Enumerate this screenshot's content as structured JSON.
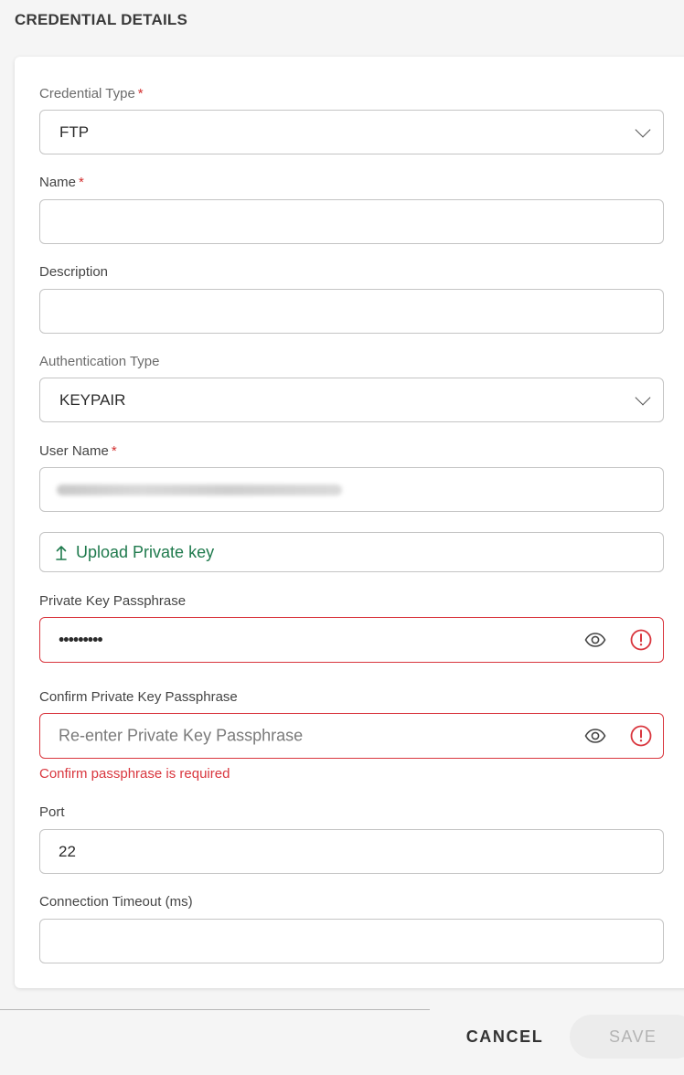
{
  "page": {
    "title": "CREDENTIAL DETAILS"
  },
  "form": {
    "credential_type": {
      "label": "Credential Type",
      "required_mark": "*",
      "value": "FTP"
    },
    "name": {
      "label": "Name",
      "required_mark": "*",
      "value": ""
    },
    "description": {
      "label": "Description",
      "value": ""
    },
    "authentication_type": {
      "label": "Authentication Type",
      "value": "KEYPAIR"
    },
    "user_name": {
      "label": "User Name",
      "required_mark": "*"
    },
    "upload": {
      "icon": "upload-arrow-icon",
      "label": "Upload Private key"
    },
    "private_key_passphrase": {
      "label": "Private Key Passphrase",
      "masked_value": "•••••••••"
    },
    "confirm_passphrase": {
      "label": "Confirm Private Key Passphrase",
      "placeholder": "Re-enter Private Key Passphrase",
      "error": "Confirm passphrase is required"
    },
    "port": {
      "label": "Port",
      "value": "22"
    },
    "connection_timeout": {
      "label": "Connection Timeout (ms)",
      "value": ""
    }
  },
  "actions": {
    "cancel": "CANCEL",
    "save": "SAVE"
  },
  "colors": {
    "accent": "#1f7a4d",
    "error": "#d9363e",
    "required": "#d32f2f",
    "disabled_text": "#b3b3b3"
  }
}
